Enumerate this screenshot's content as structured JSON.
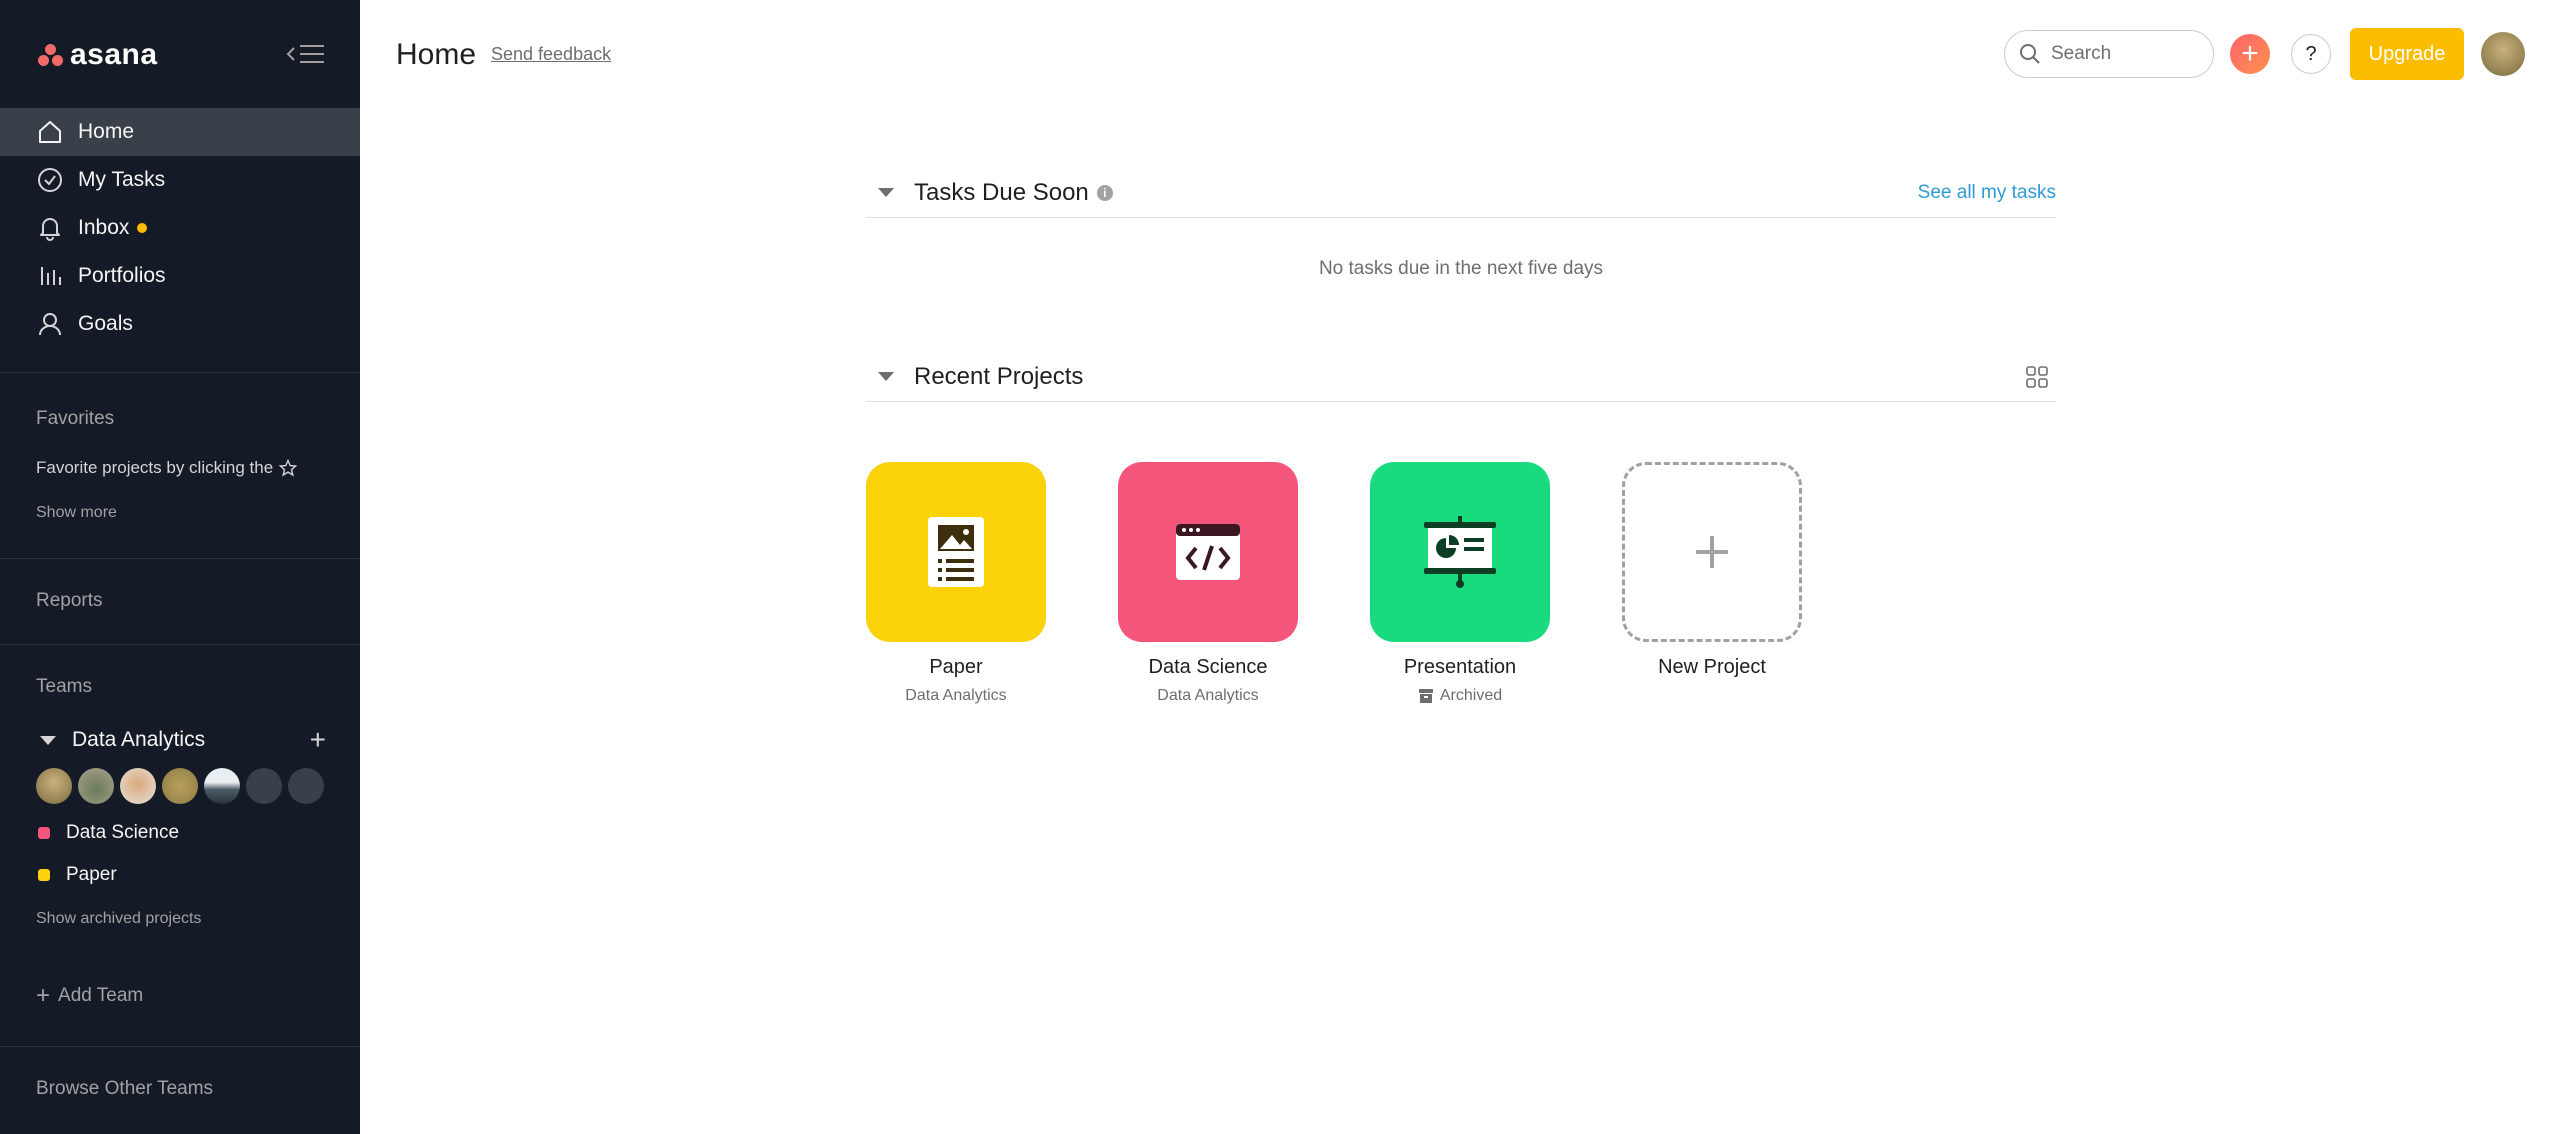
{
  "app": {
    "logo_text": "asana",
    "accent": "#f06a6a",
    "sidebar_bg": "#151b26"
  },
  "sidebar": {
    "nav": [
      {
        "label": "Home",
        "icon": "home-icon",
        "active": true
      },
      {
        "label": "My Tasks",
        "icon": "check-circle-icon"
      },
      {
        "label": "Inbox",
        "icon": "bell-icon",
        "has_dot": true
      },
      {
        "label": "Portfolios",
        "icon": "bar-chart-icon"
      },
      {
        "label": "Goals",
        "icon": "person-icon"
      }
    ],
    "favorites_label": "Favorites",
    "favorites_hint": "Favorite projects by clicking the",
    "show_more": "Show more",
    "reports_label": "Reports",
    "teams_label": "Teams",
    "team_name": "Data Analytics",
    "team_projects": [
      {
        "name": "Data Science",
        "color": "#f3567a"
      },
      {
        "name": "Paper",
        "color": "#fcd20a"
      }
    ],
    "show_archived": "Show archived projects",
    "add_team": "Add Team",
    "browse_teams": "Browse Other Teams"
  },
  "header": {
    "title": "Home",
    "feedback": "Send feedback",
    "search_placeholder": "Search",
    "help": "?",
    "upgrade": "Upgrade"
  },
  "tasks_section": {
    "title": "Tasks Due Soon",
    "see_all": "See all my tasks",
    "empty": "No tasks due in the next five days"
  },
  "projects_section": {
    "title": "Recent Projects",
    "projects": [
      {
        "name": "Paper",
        "sub": "Data Analytics",
        "color": "#fcd20a",
        "icon": "document-icon"
      },
      {
        "name": "Data Science",
        "sub": "Data Analytics",
        "color": "#f3567a",
        "icon": "code-icon"
      },
      {
        "name": "Presentation",
        "sub": "Archived",
        "color": "#19db7e",
        "icon": "presentation-icon"
      },
      {
        "name": "New Project",
        "icon": "plus-icon"
      }
    ]
  }
}
